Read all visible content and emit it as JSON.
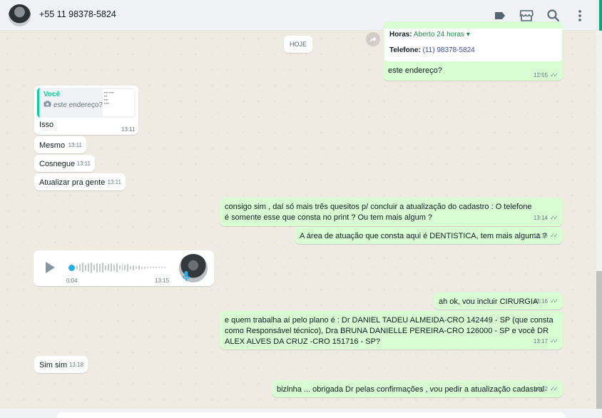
{
  "header": {
    "contact_name": "+55 11 98378-5824",
    "icons": [
      "label-icon",
      "store-icon",
      "search-icon",
      "menu-icon"
    ]
  },
  "chat": {
    "day_separator": "HOJE",
    "business_card": {
      "hours_label": "Horas:",
      "hours_value": "Aberto 24 horas ▾",
      "phone_label": "Telefone:",
      "phone_value": "(11) 98378-5824"
    },
    "messages": [
      {
        "dir": "out",
        "text": "este endereço?",
        "time": "12:55"
      },
      {
        "dir": "in",
        "quote_author": "Você",
        "quote_text": "este endereço?",
        "text": "Isso",
        "time": "13:11"
      },
      {
        "dir": "in",
        "text": "Mesmo",
        "time": "13:11"
      },
      {
        "dir": "in",
        "text": "Cosnegue",
        "time": "13:11"
      },
      {
        "dir": "in",
        "text": "Atualizar pra gente",
        "time": "13:11"
      },
      {
        "dir": "out",
        "text": "consigo sim , daí só mais três quesitos p/ concluir a atualização do cadastro : O telefone é somente esse que consta no print ? Ou tem mais algum ?",
        "time": "13:14"
      },
      {
        "dir": "out",
        "text": "A área de atuação que consta aqui é DENTISTICA, tem mais alguma ?",
        "time": "13:15"
      },
      {
        "dir": "in",
        "type": "voice",
        "duration": "0:04",
        "time": "13:15"
      },
      {
        "dir": "out",
        "text": "ah ok, vou incluir CIRURGIA",
        "time": "13:16"
      },
      {
        "dir": "out",
        "text": "e quem trabalha aí pelo plano é : Dr DANIEL TADEU ALMEIDA-CRO 142449 - SP (que consta como Responsável técnico), Dra BRUNA DANIELLE PEREIRA-CRO 126000 - SP e você DR ALEX ALVES DA CRUZ -CRO 151716 - SP?",
        "time": "13:17"
      },
      {
        "dir": "in",
        "text": "Sim sim",
        "time": "13:18"
      },
      {
        "dir": "out",
        "text": "bizinha ... obrigada Dr pelas confirmações , vou pedir a atualização cadastral",
        "time": "14:32"
      }
    ]
  }
}
